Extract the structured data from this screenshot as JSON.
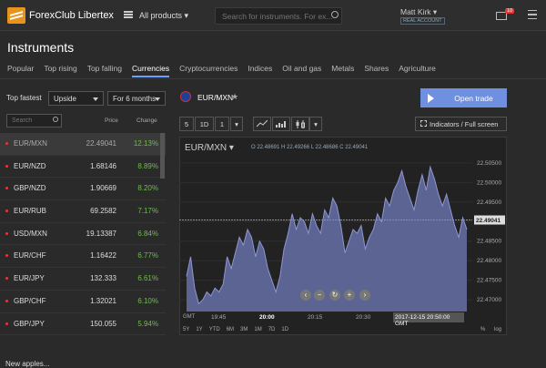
{
  "header": {
    "brand": "ForexClub Libertex",
    "all_products": "All products ▾",
    "search_placeholder": "Search for instruments. For ex...",
    "user_name": "Matt Kirk ▾",
    "account_type": "REAL ACCOUNT",
    "mail_badge": "10"
  },
  "page": {
    "title": "Instruments",
    "tabs": [
      "Popular",
      "Top rising",
      "Top falling",
      "Currencies",
      "Cryptocurrencies",
      "Indices",
      "Oil and gas",
      "Metals",
      "Shares",
      "Agriculture"
    ],
    "active_tab": "Currencies"
  },
  "list": {
    "fastest_label": "Top fastest",
    "direction": "Upside",
    "period": "For 6 months",
    "search_placeholder": "Search",
    "col_price": "Price",
    "col_change": "Change",
    "rows": [
      {
        "symbol": "EUR/MXN",
        "price": "22.49041",
        "change": "12.13%"
      },
      {
        "symbol": "EUR/NZD",
        "price": "1.68146",
        "change": "8.89%"
      },
      {
        "symbol": "GBP/NZD",
        "price": "1.90669",
        "change": "8.20%"
      },
      {
        "symbol": "EUR/RUB",
        "price": "69.2582",
        "change": "7.17%"
      },
      {
        "symbol": "USD/MXN",
        "price": "19.13387",
        "change": "6.84%"
      },
      {
        "symbol": "EUR/CHF",
        "price": "1.16422",
        "change": "6.77%"
      },
      {
        "symbol": "EUR/JPY",
        "price": "132.333",
        "change": "6.61%"
      },
      {
        "symbol": "GBP/CHF",
        "price": "1.32021",
        "change": "6.10%"
      },
      {
        "symbol": "GBP/JPY",
        "price": "150.055",
        "change": "5.94%"
      }
    ]
  },
  "instrument": {
    "name": "EUR/MXN",
    "open_trade": "Open trade",
    "tf_5": "5",
    "tf_1d": "1D",
    "tf_1": "1",
    "indicators": "Indicators / Full screen",
    "pair_label": "EUR/MXN ▾",
    "ohlc": "O 22.48691  H 22.49266  L 22.48686  C 22.49041",
    "gmt": "GMT",
    "current_time": "2017-12-15 20:50:00 GMT",
    "time_labels": [
      "19:45",
      "20:00",
      "20:15",
      "20:30"
    ],
    "ranges": [
      "5Y",
      "1Y",
      "YTD",
      "6M",
      "3M",
      "1M",
      "7D",
      "1D"
    ],
    "pct": "%",
    "log": "log"
  },
  "chart_data": {
    "type": "area",
    "y_ticks": [
      22.505,
      22.5,
      22.495,
      22.49,
      22.485,
      22.48,
      22.475,
      22.47
    ],
    "ylim": [
      22.467,
      22.508
    ],
    "current_value": 22.49041,
    "current_label": "22.49041",
    "x_labels": [
      "19:45",
      "20:00",
      "20:15",
      "20:30"
    ],
    "values": [
      22.476,
      22.481,
      22.473,
      22.469,
      22.47,
      22.472,
      22.471,
      22.473,
      22.472,
      22.474,
      22.481,
      22.478,
      22.482,
      22.486,
      22.484,
      22.488,
      22.486,
      22.481,
      22.485,
      22.483,
      22.478,
      22.475,
      22.472,
      22.476,
      22.483,
      22.487,
      22.492,
      22.488,
      22.491,
      22.49,
      22.487,
      22.492,
      22.489,
      22.487,
      22.493,
      22.491,
      22.496,
      22.494,
      22.489,
      22.482,
      22.485,
      22.488,
      22.487,
      22.489,
      22.483,
      22.486,
      22.488,
      22.492,
      22.49,
      22.496,
      22.494,
      22.498,
      22.5,
      22.503,
      22.499,
      22.496,
      22.493,
      22.498,
      22.502,
      22.498,
      22.504,
      22.501,
      22.497,
      22.494,
      22.497,
      22.493,
      22.489,
      22.486,
      22.491,
      22.488
    ],
    "colors": {
      "fill": "#5c6494",
      "line": "#8e97d2",
      "current": "#6f8fe0"
    }
  },
  "bottom": {
    "text": "New apples..."
  }
}
